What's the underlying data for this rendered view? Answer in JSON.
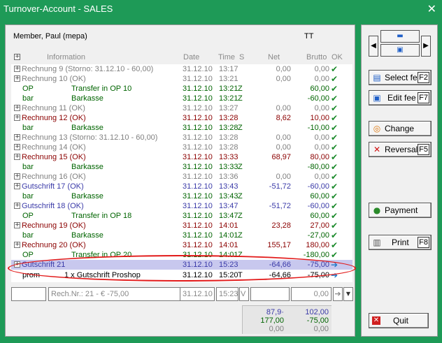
{
  "window": {
    "title": "Turnover-Account - SALES",
    "close": "✕"
  },
  "header": {
    "member": "Member, Paul (mepa)",
    "tt": "TT"
  },
  "columns": {
    "info": "Information",
    "date": "Date",
    "time": "Time",
    "s": "S",
    "net": "Net",
    "brutto": "Brutto",
    "ok": "OK"
  },
  "rows": [
    {
      "type": "main",
      "color": "gray",
      "info": "Rechnung 9 (Storno: 31.12.10 - 60,00)",
      "date": "31.12.10",
      "time": "13:17",
      "s": "",
      "net": "0,00",
      "brutto": "0,00",
      "ok": "✔"
    },
    {
      "type": "main",
      "color": "gray",
      "info": "Rechnung 10 (OK)",
      "date": "31.12.10",
      "time": "13:21",
      "s": "",
      "net": "0,00",
      "brutto": "0,00",
      "ok": "✔"
    },
    {
      "type": "sub",
      "color": "green",
      "info": "OP",
      "info2": "Transfer in OP 10",
      "date": "31.12.10",
      "time": "13:21",
      "s": "Z",
      "net": "",
      "brutto": "60,00",
      "ok": "✔"
    },
    {
      "type": "sub",
      "color": "green",
      "info": "bar",
      "info2": "Barkasse",
      "date": "31.12.10",
      "time": "13:21",
      "s": "Z",
      "net": "",
      "brutto": "-60,00",
      "ok": "✔"
    },
    {
      "type": "main",
      "color": "gray",
      "info": "Rechnung 11 (OK)",
      "date": "31.12.10",
      "time": "13:27",
      "s": "",
      "net": "0,00",
      "brutto": "0,00",
      "ok": "✔"
    },
    {
      "type": "main",
      "color": "red",
      "info": "Rechnung 12 (OK)",
      "date": "31.12.10",
      "time": "13:28",
      "s": "",
      "net": "8,62",
      "brutto": "10,00",
      "ok": "✔"
    },
    {
      "type": "sub",
      "color": "green",
      "info": "bar",
      "info2": "Barkasse",
      "date": "31.12.10",
      "time": "13:28",
      "s": "Z",
      "net": "",
      "brutto": "-10,00",
      "ok": "✔"
    },
    {
      "type": "main",
      "color": "gray",
      "info": "Rechnung 13 (Storno: 31.12.10 - 60,00)",
      "date": "31.12.10",
      "time": "13:28",
      "s": "",
      "net": "0,00",
      "brutto": "0,00",
      "ok": "✔"
    },
    {
      "type": "main",
      "color": "gray",
      "info": "Rechnung 14 (OK)",
      "date": "31.12.10",
      "time": "13:28",
      "s": "",
      "net": "0,00",
      "brutto": "0,00",
      "ok": "✔"
    },
    {
      "type": "main",
      "color": "red",
      "info": "Rechnung 15 (OK)",
      "date": "31.12.10",
      "time": "13:33",
      "s": "",
      "net": "68,97",
      "brutto": "80,00",
      "ok": "✔"
    },
    {
      "type": "sub",
      "color": "green",
      "info": "bar",
      "info2": "Barkasse",
      "date": "31.12.10",
      "time": "13:33",
      "s": "Z",
      "net": "",
      "brutto": "-80,00",
      "ok": "✔"
    },
    {
      "type": "main",
      "color": "gray",
      "info": "Rechnung 16 (OK)",
      "date": "31.12.10",
      "time": "13:36",
      "s": "",
      "net": "0,00",
      "brutto": "0,00",
      "ok": "✔"
    },
    {
      "type": "main",
      "color": "blue",
      "info": "Gutschrift 17 (OK)",
      "date": "31.12.10",
      "time": "13:43",
      "s": "",
      "net": "-51,72",
      "brutto": "-60,00",
      "ok": "✔"
    },
    {
      "type": "sub",
      "color": "green",
      "info": "bar",
      "info2": "Barkasse",
      "date": "31.12.10",
      "time": "13:43",
      "s": "Z",
      "net": "",
      "brutto": "60,00",
      "ok": "✔"
    },
    {
      "type": "main",
      "color": "blue",
      "info": "Gutschrift 18 (OK)",
      "date": "31.12.10",
      "time": "13:47",
      "s": "",
      "net": "-51,72",
      "brutto": "-60,00",
      "ok": "✔"
    },
    {
      "type": "sub",
      "color": "green",
      "info": "OP",
      "info2": "Transfer in OP 18",
      "date": "31.12.10",
      "time": "13:47",
      "s": "Z",
      "net": "",
      "brutto": "60,00",
      "ok": "✔"
    },
    {
      "type": "main",
      "color": "red",
      "info": "Rechnung 19 (OK)",
      "date": "31.12.10",
      "time": "14:01",
      "s": "",
      "net": "23,28",
      "brutto": "27,00",
      "ok": "✔"
    },
    {
      "type": "sub",
      "color": "green",
      "info": "bar",
      "info2": "Barkasse",
      "date": "31.12.10",
      "time": "14:01",
      "s": "Z",
      "net": "",
      "brutto": "-27,00",
      "ok": "✔"
    },
    {
      "type": "main",
      "color": "red",
      "info": "Rechnung 20 (OK)",
      "date": "31.12.10",
      "time": "14:01",
      "s": "",
      "net": "155,17",
      "brutto": "180,00",
      "ok": "✔"
    },
    {
      "type": "sub",
      "color": "green",
      "info": "OP",
      "info2": "Transfer in OP 20",
      "date": "31.12.10",
      "time": "14:01",
      "s": "Z",
      "net": "",
      "brutto": "-180,00",
      "ok": "✔"
    },
    {
      "type": "main",
      "color": "blue",
      "info": "Gutschrift 21",
      "date": "31.12.10",
      "time": "15:23",
      "s": "",
      "net": "-64,66",
      "brutto": "-75,00",
      "ok": "➔",
      "selected": true
    }
  ],
  "detail": {
    "info": "prom",
    "info2": "1 x Gutschrift Proshop",
    "date": "31.12.10",
    "time": "15:20",
    "s": "T",
    "net": "-64,66",
    "brutto": "-75,00",
    "ok": "➔"
  },
  "input": {
    "field1": "",
    "field2": "Rech.Nr.: 21 - € -75,00",
    "date": "31.12.10",
    "time": "15:23",
    "s": "V",
    "net": "",
    "brutto": "0,00"
  },
  "sums": {
    "net1": "87,9·",
    "brutto1": "102,00",
    "net2": "177,00",
    "brutto2": "-75,00",
    "net3": "0,00",
    "brutto3": "0,00"
  },
  "buttons": {
    "select_fee": "Select fee",
    "select_fee_key": "F2",
    "edit_fee": "Edit fee",
    "edit_fee_key": "F7",
    "change": "Change",
    "reversal": "Reversal",
    "reversal_key": "F5",
    "payment": "Payment",
    "print": "Print",
    "print_key": "F8",
    "quit": "Quit"
  },
  "colors": {
    "window": "#1e9a57",
    "gray": "#808080",
    "red": "#8b0000",
    "green": "#006400",
    "blue": "#3a3aa8",
    "ok": "#1a8a2a",
    "highlight": "#e21a1a"
  }
}
